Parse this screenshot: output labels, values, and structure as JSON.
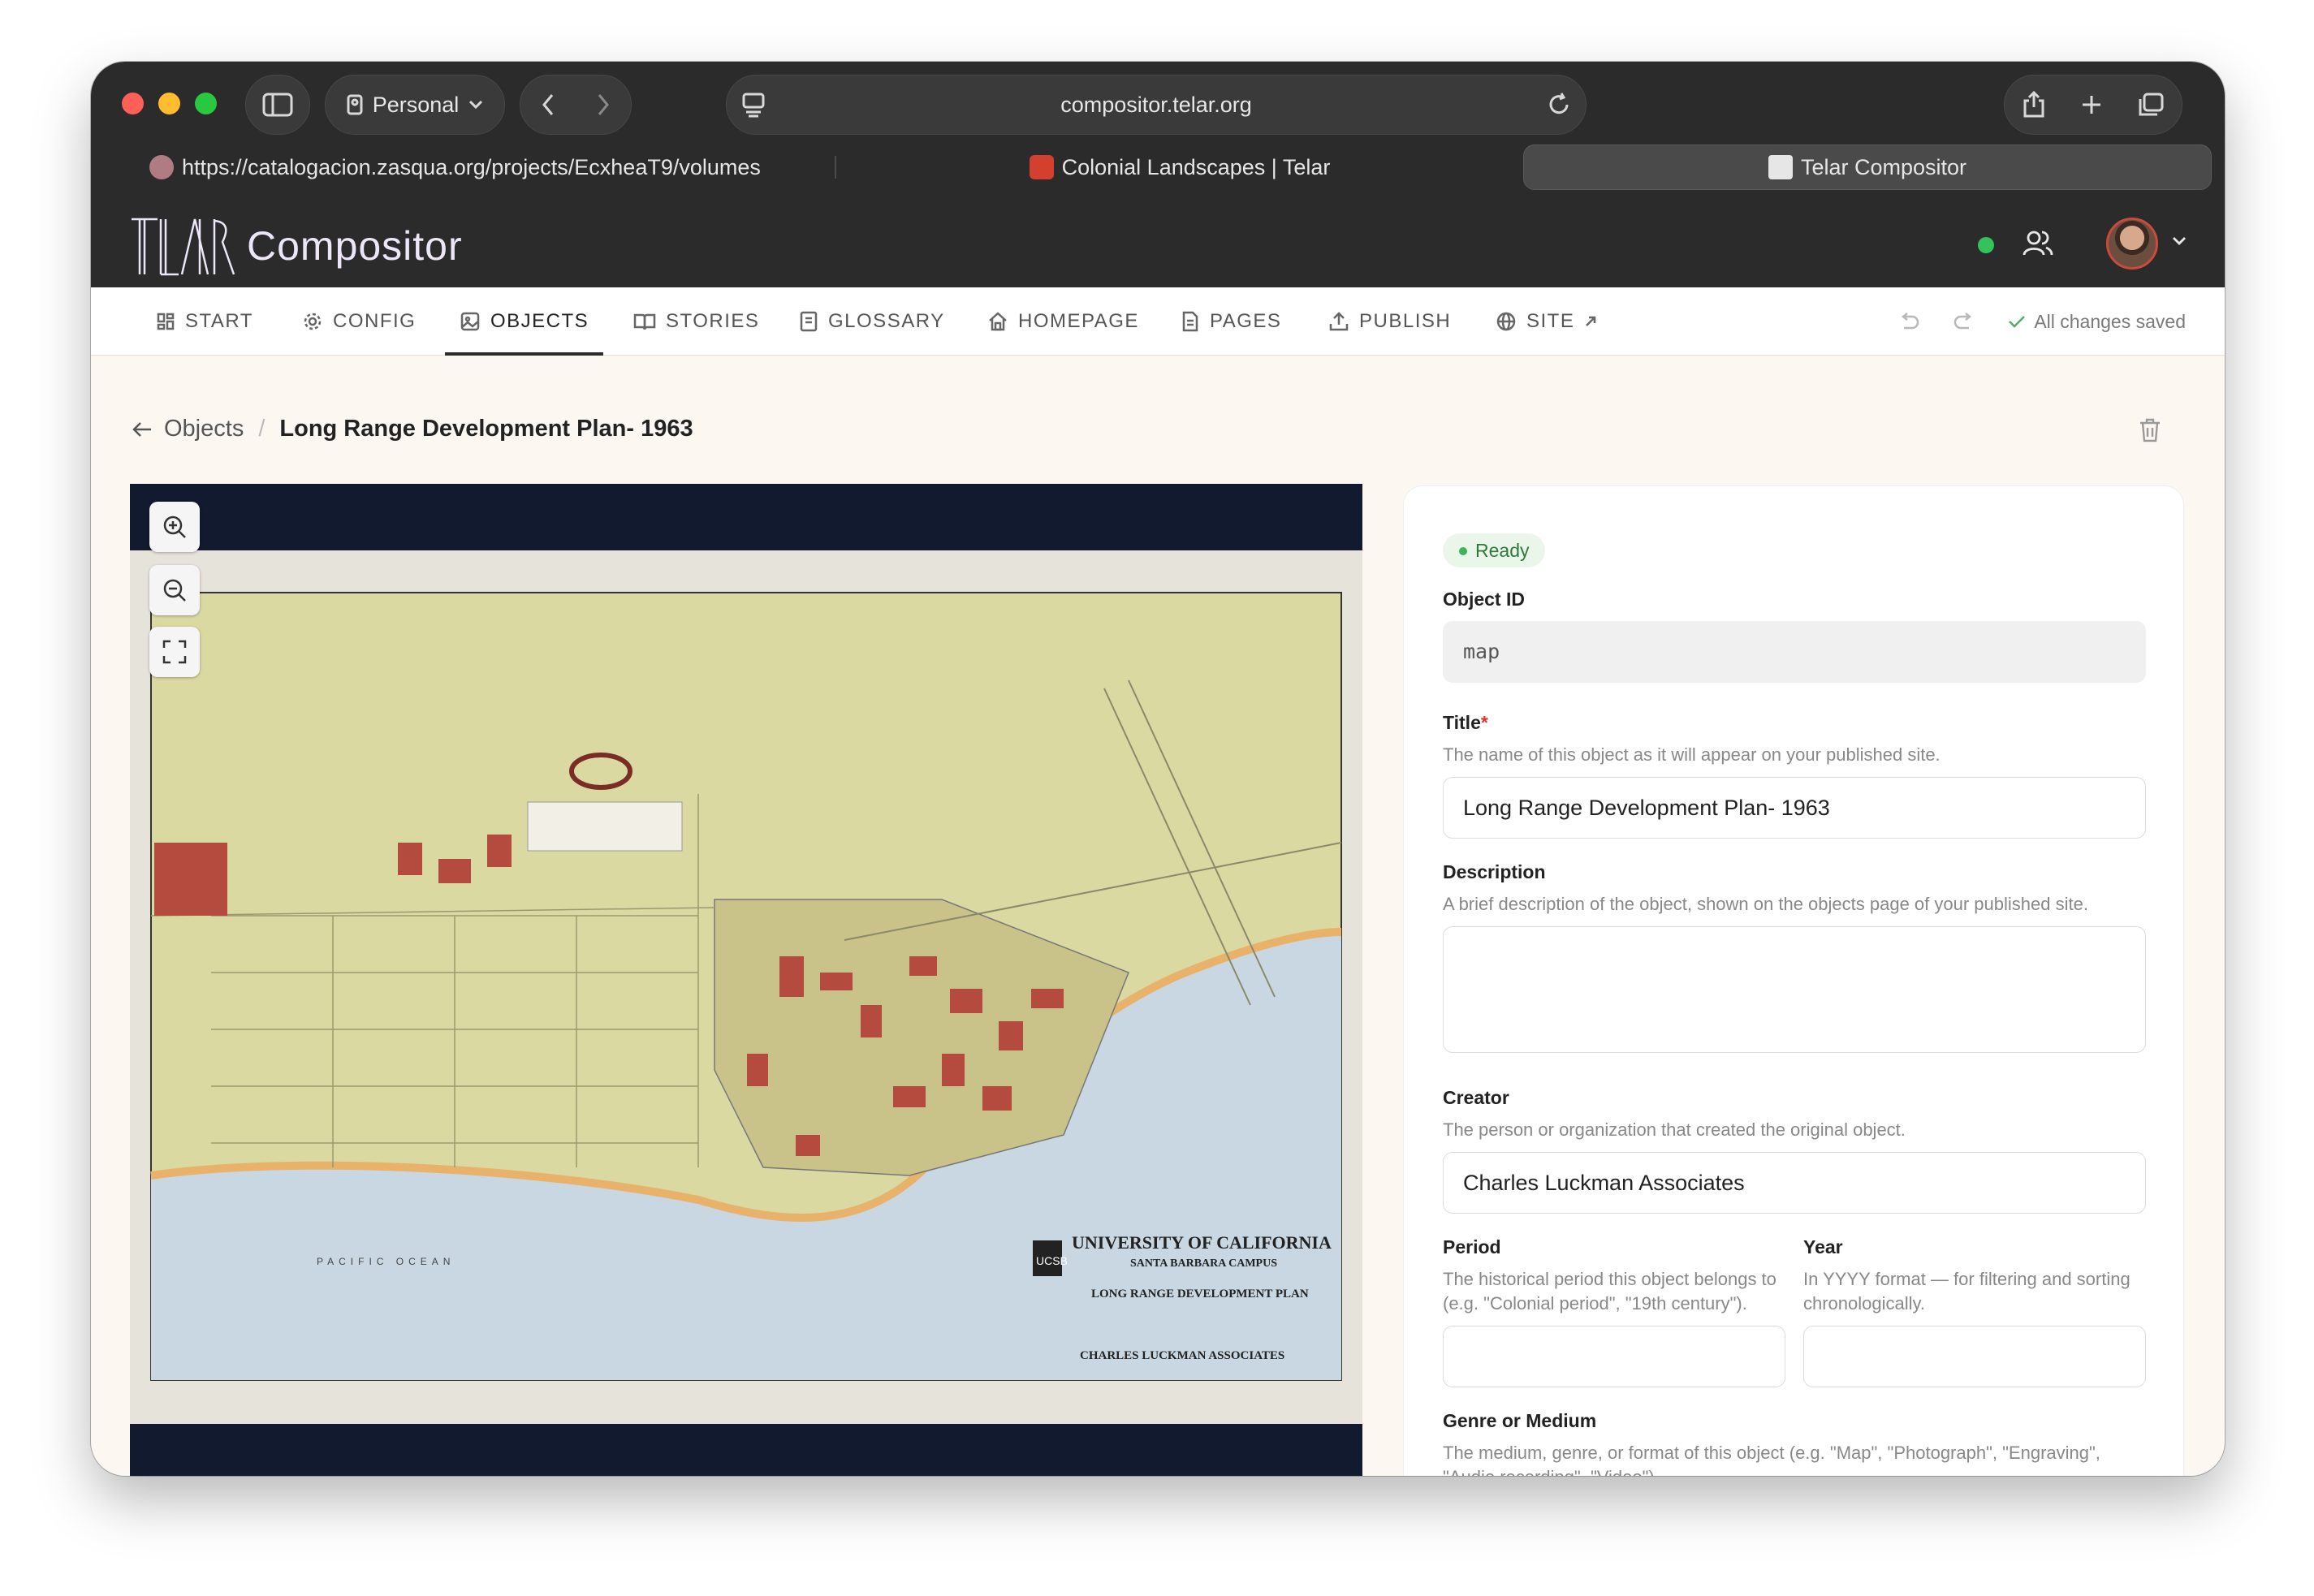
{
  "browser": {
    "profile": "Personal",
    "address": "compositor.telar.org",
    "tabs": [
      {
        "label": "https://catalogacion.zasqua.org/projects/EcxheaT9/volumes"
      },
      {
        "label": "Colonial Landscapes | Telar"
      },
      {
        "label": "Telar Compositor"
      }
    ]
  },
  "app": {
    "logo_text": "TELAR",
    "name": "Compositor",
    "status_color": "#35c25a"
  },
  "nav": {
    "items": [
      {
        "label": "START",
        "icon": "grid-icon"
      },
      {
        "label": "CONFIG",
        "icon": "gear-icon"
      },
      {
        "label": "OBJECTS",
        "icon": "image-icon"
      },
      {
        "label": "STORIES",
        "icon": "book-icon"
      },
      {
        "label": "GLOSSARY",
        "icon": "glossary-icon"
      },
      {
        "label": "HOMEPAGE",
        "icon": "home-icon"
      },
      {
        "label": "PAGES",
        "icon": "page-icon"
      },
      {
        "label": "PUBLISH",
        "icon": "upload-icon"
      },
      {
        "label": "SITE",
        "icon": "globe-icon"
      }
    ],
    "saved_text": "All changes saved"
  },
  "breadcrumb": {
    "parent": "Objects",
    "separator": "/",
    "current": "Long Range Development Plan- 1963"
  },
  "viewer": {
    "map_titles": {
      "line1": "UNIVERSITY OF CALIFORNIA",
      "line2": "SANTA BARBARA CAMPUS",
      "line3": "LONG RANGE DEVELOPMENT PLAN",
      "line4": "CHARLES LUCKMAN ASSOCIATES",
      "ocean": "PACIFIC  OCEAN",
      "logo": "UCSB"
    }
  },
  "form": {
    "status": "Ready",
    "object_id": {
      "label": "Object ID",
      "value": "map"
    },
    "title": {
      "label": "Title",
      "required": "*",
      "help": "The name of this object as it will appear on your published site.",
      "value": "Long Range Development Plan- 1963"
    },
    "description": {
      "label": "Description",
      "help": "A brief description of the object, shown on the objects page of your published site.",
      "value": ""
    },
    "creator": {
      "label": "Creator",
      "help": "The person or organization that created the original object.",
      "value": "Charles Luckman Associates"
    },
    "period": {
      "label": "Period",
      "help": "The historical period this object belongs to (e.g. \"Colonial period\", \"19th century\").",
      "value": ""
    },
    "year": {
      "label": "Year",
      "help": "In YYYY format — for filtering and sorting chronologically.",
      "value": ""
    },
    "genre": {
      "label": "Genre or Medium",
      "help": "The medium, genre, or format of this object (e.g. \"Map\", \"Photograph\", \"Engraving\", \"Audio recording\", \"Video\")."
    }
  }
}
